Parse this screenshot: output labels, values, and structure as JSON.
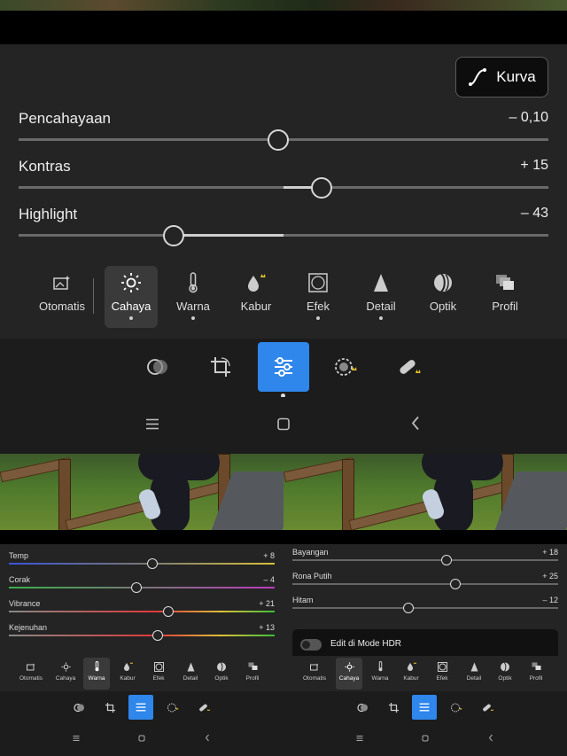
{
  "curve_button": {
    "label": "Kurva",
    "icon": "curve-icon"
  },
  "light_panel": {
    "sliders": [
      {
        "label": "Pencahayaan",
        "value": "– 0,10",
        "level": 0.49
      },
      {
        "label": "Kontras",
        "value": "+ 15",
        "level": 0.575
      },
      {
        "label": "Highlight",
        "value": "– 43",
        "level": 0.29
      }
    ]
  },
  "categories": [
    {
      "label": "Otomatis",
      "icon": "auto-image-icon"
    },
    {
      "label": "Cahaya",
      "icon": "sun-icon",
      "active": true
    },
    {
      "label": "Warna",
      "icon": "thermometer-icon"
    },
    {
      "label": "Kabur",
      "icon": "blur-drop-icon"
    },
    {
      "label": "Efek",
      "icon": "vignette-icon"
    },
    {
      "label": "Detail",
      "icon": "triangle-icon"
    },
    {
      "label": "Optik",
      "icon": "lens-icon"
    },
    {
      "label": "Profil",
      "icon": "profile-stack-icon"
    }
  ],
  "tools": [
    "presets-icon",
    "crop-icon",
    "edit-sliders-icon",
    "masking-icon",
    "healing-icon"
  ],
  "nav": [
    "menu-icon",
    "home-icon",
    "back-icon"
  ],
  "color_panel": {
    "sliders": [
      {
        "label": "Temp",
        "value": "+ 8",
        "level": 0.54
      },
      {
        "label": "Corak",
        "value": "– 4",
        "level": 0.48
      },
      {
        "label": "Vibrance",
        "value": "+ 21",
        "level": 0.6
      },
      {
        "label": "Kejenuhan",
        "value": "+ 13",
        "level": 0.56
      }
    ],
    "active_category": "Warna"
  },
  "tone_panel": {
    "sliders": [
      {
        "label": "Bayangan",
        "value": "+ 18",
        "level": 0.58
      },
      {
        "label": "Rona Putih",
        "value": "+ 25",
        "level": 0.61
      },
      {
        "label": "Hitam",
        "value": "– 12",
        "level": 0.44
      }
    ],
    "hdr_label": "Edit di Mode HDR",
    "active_category": "Cahaya"
  },
  "colors": {
    "accent": "#2f86eb",
    "panel": "#242424",
    "premium": "#e6c229"
  }
}
